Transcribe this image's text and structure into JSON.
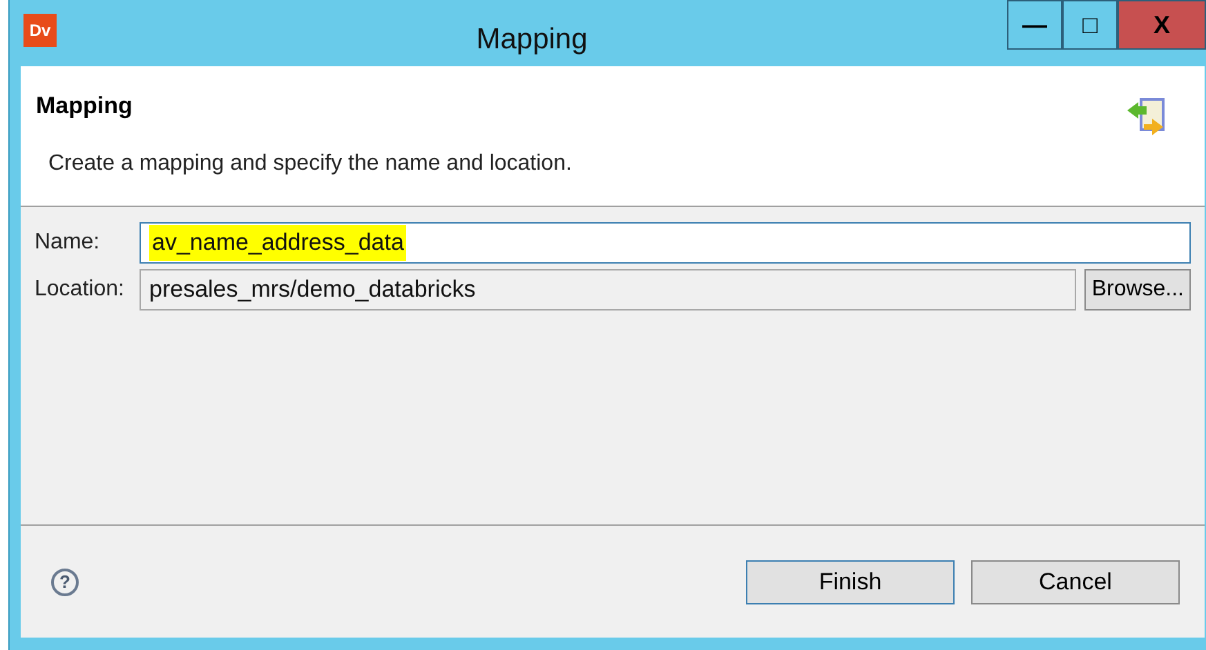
{
  "window": {
    "app_icon": "Dv",
    "title": "Mapping",
    "controls": [
      "—",
      "□",
      "X"
    ]
  },
  "header": {
    "title": "Mapping",
    "description": "Create a mapping and specify the name and location."
  },
  "fields": [
    {
      "label": "Name:",
      "value": "av_name_address_data",
      "highlighted": true,
      "readonly": false
    },
    {
      "label": "Location:",
      "value": "presales_mrs/demo_databricks",
      "highlighted": false,
      "readonly": true,
      "button": "Browse..."
    }
  ],
  "footer": {
    "help": "?",
    "buttons": [
      {
        "label": "Finish",
        "default": true
      },
      {
        "label": "Cancel",
        "default": false
      }
    ]
  }
}
